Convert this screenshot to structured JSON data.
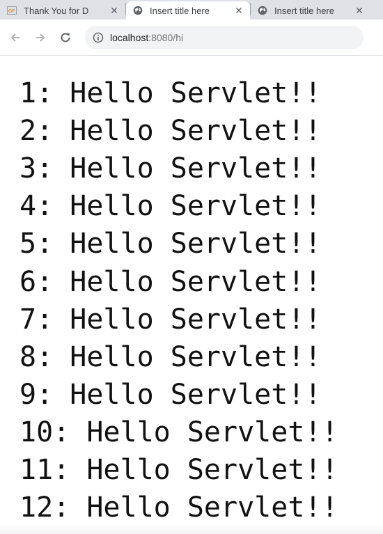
{
  "tabs": [
    {
      "title": "Thank You for D",
      "icon": "page-favicon-icon",
      "active": false
    },
    {
      "title": "Insert title here",
      "icon": "globe-icon",
      "active": true
    },
    {
      "title": "Insert title here",
      "icon": "globe-icon",
      "active": false
    }
  ],
  "address": {
    "host": "localhost",
    "rest": ":8080/hi"
  },
  "lines": [
    "1: Hello Servlet!!",
    "2: Hello Servlet!!",
    "3: Hello Servlet!!",
    "4: Hello Servlet!!",
    "5: Hello Servlet!!",
    "6: Hello Servlet!!",
    "7: Hello Servlet!!",
    "8: Hello Servlet!!",
    "9: Hello Servlet!!",
    "10: Hello Servlet!!",
    "11: Hello Servlet!!",
    "12: Hello Servlet!!"
  ]
}
